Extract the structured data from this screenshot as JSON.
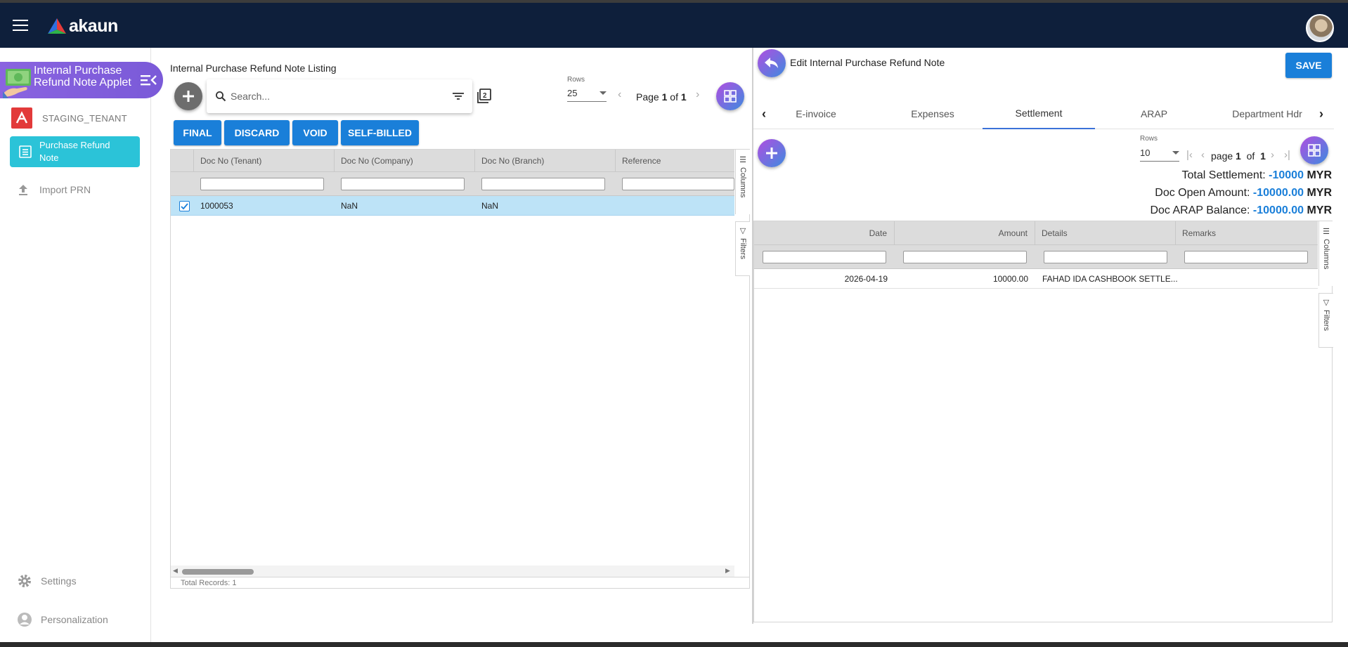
{
  "app": {
    "brand": "akaun",
    "applet_title": "Internal Purchase Refund Note Applet",
    "tenant": "STAGING_TENANT"
  },
  "sidebar": {
    "items": [
      {
        "label": "Purchase Refund Note",
        "icon": "list-icon",
        "active": true
      },
      {
        "label": "Import PRN",
        "icon": "upload-icon",
        "active": false
      }
    ],
    "bottom": [
      {
        "label": "Settings",
        "icon": "gear-icon"
      },
      {
        "label": "Personalization",
        "icon": "person-icon"
      }
    ]
  },
  "listing": {
    "title": "Internal Purchase Refund Note Listing",
    "search_placeholder": "Search...",
    "rows_label": "Rows",
    "rows_value": "25",
    "pager_prefix": "Page",
    "page": "1",
    "pager_of": "of",
    "total_pages": "1",
    "actions": [
      "FINAL",
      "DISCARD",
      "VOID",
      "SELF-BILLED"
    ],
    "columns": [
      "Doc No (Tenant)",
      "Doc No (Company)",
      "Doc No (Branch)",
      "Reference"
    ],
    "rows": [
      {
        "selected": true,
        "cells": [
          "1000053",
          "NaN",
          "NaN",
          ""
        ]
      }
    ],
    "side_tools": [
      "Columns",
      "Filters"
    ],
    "footer": "Total Records: 1"
  },
  "edit": {
    "title": "Edit Internal Purchase Refund Note",
    "save_label": "SAVE",
    "tabs": [
      "E-invoice",
      "Expenses",
      "Settlement",
      "ARAP",
      "Department Hdr"
    ],
    "active_tab": "Settlement",
    "rows_label": "Rows",
    "rows_value": "10",
    "pager_prefix": "page",
    "page": "1",
    "pager_of": "of",
    "total_pages": "1",
    "summary": [
      {
        "label": "Total Settlement:",
        "value": "-10000",
        "currency": "MYR"
      },
      {
        "label": "Doc Open Amount:",
        "value": "-10000.00",
        "currency": "MYR"
      },
      {
        "label": "Doc ARAP Balance:",
        "value": "-10000.00",
        "currency": "MYR"
      }
    ],
    "columns": [
      "Date",
      "Amount",
      "Details",
      "Remarks"
    ],
    "rows": [
      {
        "cells": [
          "2026-04-19",
          "10000.00",
          "FAHAD IDA CASHBOOK SETTLE...",
          ""
        ]
      }
    ],
    "side_tools": [
      "Columns",
      "Filters"
    ]
  },
  "colors": {
    "topbar": "#0e1f3b",
    "accent_blue": "#1a7fd9",
    "sidebar_active": "#2bc3d8",
    "applet_purple": "#8a63e0",
    "row_selected": "#bde3f7"
  }
}
